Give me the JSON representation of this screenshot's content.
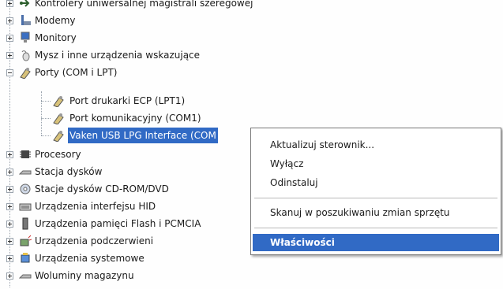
{
  "tree": {
    "items": [
      {
        "label": "Kontrolery uniwersalnej magistrali szeregowej",
        "icon": "usb-controller-icon"
      },
      {
        "label": "Modemy",
        "icon": "modem-icon"
      },
      {
        "label": "Monitory",
        "icon": "monitor-icon"
      },
      {
        "label": "Mysz i inne urządzenia wskazujące",
        "icon": "mouse-icon"
      },
      {
        "label": "Porty (COM i LPT)",
        "icon": "port-icon"
      },
      {
        "label": "Port drukarki ECP (LPT1)",
        "icon": "port-icon"
      },
      {
        "label": "Port komunikacyjny (COM1)",
        "icon": "port-icon"
      },
      {
        "label": "Vaken USB LPG Interface (COM",
        "icon": "port-icon"
      },
      {
        "label": "Procesory",
        "icon": "processor-icon"
      },
      {
        "label": "Stacja dysków",
        "icon": "floppy-drive-icon"
      },
      {
        "label": "Stacje dysków CD-ROM/DVD",
        "icon": "cdrom-icon"
      },
      {
        "label": "Urządzenia interfejsu HID",
        "icon": "hid-icon"
      },
      {
        "label": "Urządzenia pamięci Flash i PCMCIA",
        "icon": "flash-memory-icon"
      },
      {
        "label": "Urządzenia podczerwieni",
        "icon": "infrared-icon"
      },
      {
        "label": "Urządzenia systemowe",
        "icon": "system-device-icon"
      },
      {
        "label": "Woluminy magazynu",
        "icon": "storage-volume-icon"
      }
    ]
  },
  "context_menu": {
    "items": [
      {
        "label": "Aktualizuj sterownik..."
      },
      {
        "label": "Wyłącz"
      },
      {
        "label": "Odinstaluj"
      },
      {
        "label": "Skanuj w poszukiwaniu zmian sprzętu"
      },
      {
        "label": "Właściwości"
      }
    ]
  },
  "colors": {
    "selection": "#316ac5",
    "tree_lines": "#9aa3ad"
  }
}
